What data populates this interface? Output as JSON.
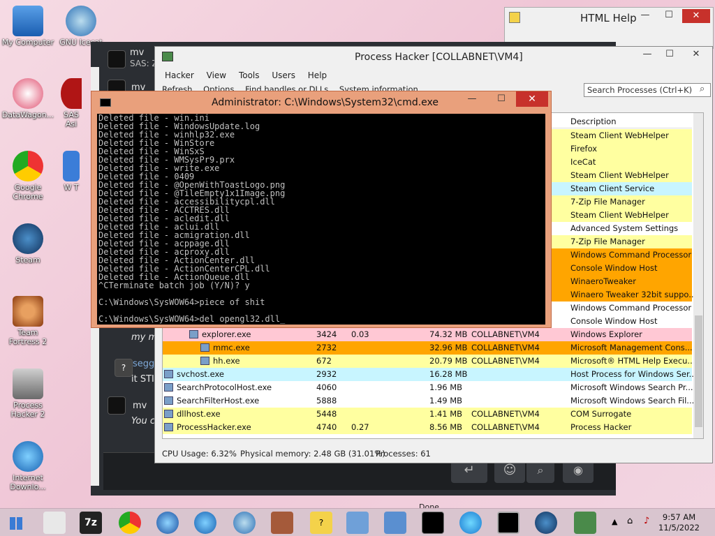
{
  "desktop": {
    "icons": [
      {
        "label": "My Computer"
      },
      {
        "label": "GNU Icecat"
      },
      {
        "label": "DataWagon..."
      },
      {
        "label": "SAS Asi"
      },
      {
        "label": "Google Chrome"
      },
      {
        "label": "W T"
      },
      {
        "label": "Steam"
      },
      {
        "label": "Team Fortress 2"
      },
      {
        "label": "Process Hacker 2"
      },
      {
        "label": "Internet Downlo..."
      }
    ]
  },
  "help": {
    "title": "HTML Help",
    "close": "✕"
  },
  "chat": {
    "header_user": "mv",
    "header_status": "SAS: Z",
    "mid_user": "mv",
    "msg1": "my m",
    "user2": "segg",
    "msg2": "it STI",
    "user3": "mv",
    "msg3": "You c",
    "done": "Done"
  },
  "ph": {
    "title": "Process Hacker [COLLABNET\\VM4]",
    "menu": [
      "Hacker",
      "View",
      "Tools",
      "Users",
      "Help"
    ],
    "tools": [
      "Refresh",
      "Options",
      "Find handles or DLLs",
      "System information"
    ],
    "search_placeholder": "Search Processes (Ctrl+K)",
    "col_description": "Description",
    "desc_rows": [
      "Steam Client WebHelper",
      "Firefox",
      "IceCat",
      "Steam Client WebHelper",
      "Steam Client Service",
      "7-Zip File Manager",
      "Steam Client WebHelper",
      "Advanced System Settings",
      "7-Zip File Manager",
      "Windows Command Processor",
      "Console Window Host",
      "WinaeroTweaker",
      "Winaero Tweaker 32bit suppo...",
      "Windows Command Processor",
      "Console Window Host"
    ],
    "rows": [
      {
        "name": "explorer.exe",
        "pid": "3424",
        "cpu": "0.03",
        "mem": "74.32 MB",
        "user": "COLLABNET\\VM4",
        "desc": "Windows Explorer"
      },
      {
        "name": "mmc.exe",
        "pid": "2732",
        "cpu": "",
        "mem": "32.96 MB",
        "user": "COLLABNET\\VM4",
        "desc": "Microsoft Management Cons..."
      },
      {
        "name": "hh.exe",
        "pid": "672",
        "cpu": "",
        "mem": "20.79 MB",
        "user": "COLLABNET\\VM4",
        "desc": "Microsoft® HTML Help Execu..."
      },
      {
        "name": "svchost.exe",
        "pid": "2932",
        "cpu": "",
        "mem": "16.28 MB",
        "user": "",
        "desc": "Host Process for Windows Ser..."
      },
      {
        "name": "SearchProtocolHost.exe",
        "pid": "4060",
        "cpu": "",
        "mem": "1.96 MB",
        "user": "",
        "desc": "Microsoft Windows Search Pr..."
      },
      {
        "name": "SearchFilterHost.exe",
        "pid": "5888",
        "cpu": "",
        "mem": "1.49 MB",
        "user": "",
        "desc": "Microsoft Windows Search Fil..."
      },
      {
        "name": "dllhost.exe",
        "pid": "5448",
        "cpu": "",
        "mem": "1.41 MB",
        "user": "COLLABNET\\VM4",
        "desc": "COM Surrogate"
      },
      {
        "name": "ProcessHacker.exe",
        "pid": "4740",
        "cpu": "0.27",
        "mem": "8.56 MB",
        "user": "COLLABNET\\VM4",
        "desc": "Process Hacker"
      }
    ],
    "status_cpu": "CPU Usage: 6.32%",
    "status_mem": "Physical memory: 2.48 GB (31.01%)",
    "status_proc": "Processes: 61"
  },
  "cmd": {
    "title": "Administrator:  C:\\Windows\\System32\\cmd.exe",
    "close": "✕",
    "lines": [
      "Deleted file - win.ini",
      "Deleted file - WindowsUpdate.log",
      "Deleted file - winhlp32.exe",
      "Deleted file - WinStore",
      "Deleted file - WinSxS",
      "Deleted file - WMSysPr9.prx",
      "Deleted file - write.exe",
      "Deleted file - 0409",
      "Deleted file - @OpenWithToastLogo.png",
      "Deleted file - @TileEmpty1x1Image.png",
      "Deleted file - accessibilitycpl.dll",
      "Deleted file - ACCTRES.dll",
      "Deleted file - acledit.dll",
      "Deleted file - aclui.dll",
      "Deleted file - acmigration.dll",
      "Deleted file - acppage.dll",
      "Deleted file - acproxy.dll",
      "Deleted file - ActionCenter.dll",
      "Deleted file - ActionCenterCPL.dll",
      "Deleted file - ActionQueue.dll",
      "^CTerminate batch job (Y/N)? y",
      "",
      "C:\\Windows\\SysWOW64>piece of shit",
      "",
      "C:\\Windows\\SysWOW64>del opengl32.dll_"
    ]
  },
  "taskbar": {
    "time": "9:57 AM",
    "date": "11/5/2022"
  },
  "colors": {
    "yellow": "#ffffa0",
    "orange": "#ffa500",
    "cyan": "#c8f5ff",
    "pink": "#ffc8d4",
    "white": "#ffffff"
  }
}
